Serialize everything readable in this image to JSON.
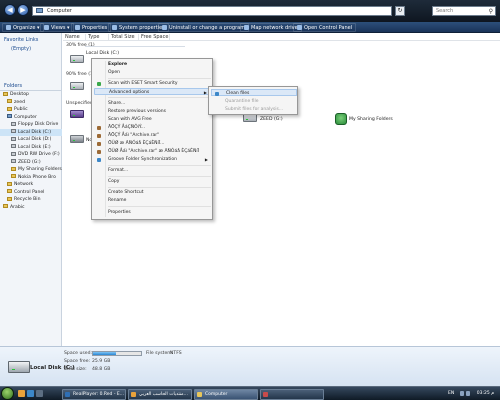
{
  "address_bar": {
    "path": "Computer",
    "search_placeholder": "Search",
    "back_glyph": "◀",
    "forward_glyph": "▶",
    "refresh_glyph": "↻",
    "search_glyph": "⚲"
  },
  "toolbar": {
    "items": [
      "Organize ▾",
      "Views ▾",
      "Properties",
      "System properties",
      "Uninstall or change a program",
      "Map network drive",
      "Open Control Panel"
    ]
  },
  "left_pane": {
    "favorite_links_title": "Favorite Links",
    "favorite_links_empty": "(Empty)",
    "folders_title": "Folders",
    "tree": [
      {
        "label": "Desktop",
        "icon": "folder-icon"
      },
      {
        "label": "zeed",
        "icon": "folder-icon"
      },
      {
        "label": "Public",
        "icon": "folder-icon"
      },
      {
        "label": "Computer",
        "icon": "computer-icon"
      },
      {
        "label": "Floppy Disk Drive",
        "icon": "drive-icon"
      },
      {
        "label": "Local Disk (C:)",
        "icon": "drive-icon"
      },
      {
        "label": "Local Disk (D:)",
        "icon": "drive-icon"
      },
      {
        "label": "Local Disk (E:)",
        "icon": "drive-icon"
      },
      {
        "label": "DVD RW Drive (F:)",
        "icon": "drive-icon"
      },
      {
        "label": "ZEED (G:)",
        "icon": "drive-icon"
      },
      {
        "label": "My Sharing Folders",
        "icon": "folder-icon"
      },
      {
        "label": "Nokia Phone Bro",
        "icon": "folder-icon"
      },
      {
        "label": "Network",
        "icon": "folder-icon"
      },
      {
        "label": "Control Panel",
        "icon": "folder-icon"
      },
      {
        "label": "Recycle Bin",
        "icon": "folder-icon"
      },
      {
        "label": "Arabic",
        "icon": "folder-icon"
      }
    ]
  },
  "content": {
    "columns": [
      "Name",
      "Type",
      "Total Size",
      "Free Space"
    ],
    "free_label_1": "30% free (1)",
    "drive_c_label": "Local Disk (C:)",
    "free_label_2": "90% free (1)",
    "removable_label": "Unspecified (2)",
    "zeed_label": "ZEED (G:)",
    "sharing_label": "My Sharing Folders",
    "partial_label": "Nok"
  },
  "context_menu": {
    "items": [
      {
        "label": "Explore",
        "bold": true,
        "icon": ""
      },
      {
        "label": "Open",
        "bold": false,
        "icon": ""
      },
      {
        "sep": true
      },
      {
        "label": "Scan with ESET Smart Security",
        "bold": false,
        "icon": "eset-icon"
      },
      {
        "label": "Advanced options",
        "bold": false,
        "icon": "",
        "arrow": "▶",
        "highlight": true
      },
      {
        "sep": true
      },
      {
        "label": "Share...",
        "bold": false,
        "icon": ""
      },
      {
        "label": "Restore previous versions",
        "bold": false,
        "icon": ""
      },
      {
        "label": "Scan with AVG Free",
        "bold": false,
        "icon": ""
      },
      {
        "label": "ÄÖÇÝ ÅáÇÑÔíÝ...",
        "bold": false,
        "icon": "archive-icon"
      },
      {
        "label": "ÄÖÇÝ Åáì \"Archive.rar\"",
        "bold": false,
        "icon": "archive-icon"
      },
      {
        "label": "ÖÛØ æ ÃÑÓáå ÈÇáÈÑíÏ...",
        "bold": false,
        "icon": "archive-icon"
      },
      {
        "label": "ÖÛØ Åáì \"Archive.rar\" æ ÃÑÓáå ÈÇáÈÑíÏ",
        "bold": false,
        "icon": "archive-icon"
      },
      {
        "label": "Groove Folder Synchronization",
        "bold": false,
        "icon": "groove-icon",
        "arrow": "▶"
      },
      {
        "sep": true
      },
      {
        "label": "Format...",
        "bold": false,
        "icon": ""
      },
      {
        "sep": true
      },
      {
        "label": "Copy",
        "bold": false,
        "icon": ""
      },
      {
        "sep": true
      },
      {
        "label": "Create Shortcut",
        "bold": false,
        "icon": ""
      },
      {
        "label": "Rename",
        "bold": false,
        "icon": ""
      },
      {
        "sep": true
      },
      {
        "label": "Properties",
        "bold": false,
        "icon": ""
      }
    ]
  },
  "sub_menu": {
    "items": [
      {
        "label": "Clean files",
        "highlight": true,
        "disabled": false
      },
      {
        "label": "Quarantine file",
        "highlight": false,
        "disabled": true
      },
      {
        "label": "Submit files for analysis...",
        "highlight": false,
        "disabled": true
      }
    ]
  },
  "details": {
    "name": "Local Disk (C:)",
    "space_used_label": "Space used:",
    "file_system_label": "File system:",
    "file_system_value": "NTFS",
    "space_free_label": "Space free:",
    "space_free_value": "25.9 GB",
    "total_size_label": "Total size:",
    "total_size_value": "48.8 GB",
    "space_used_fraction": 0.47
  },
  "taskbar": {
    "buttons": [
      {
        "label": "RealPlayer: 0.Red - E...",
        "active": false
      },
      {
        "label": "منتديات الحاسب العربي...",
        "active": false
      },
      {
        "label": "Computer",
        "active": true
      },
      {
        "label": "",
        "active": false
      }
    ],
    "language": "EN",
    "clock": "03:25 م"
  }
}
